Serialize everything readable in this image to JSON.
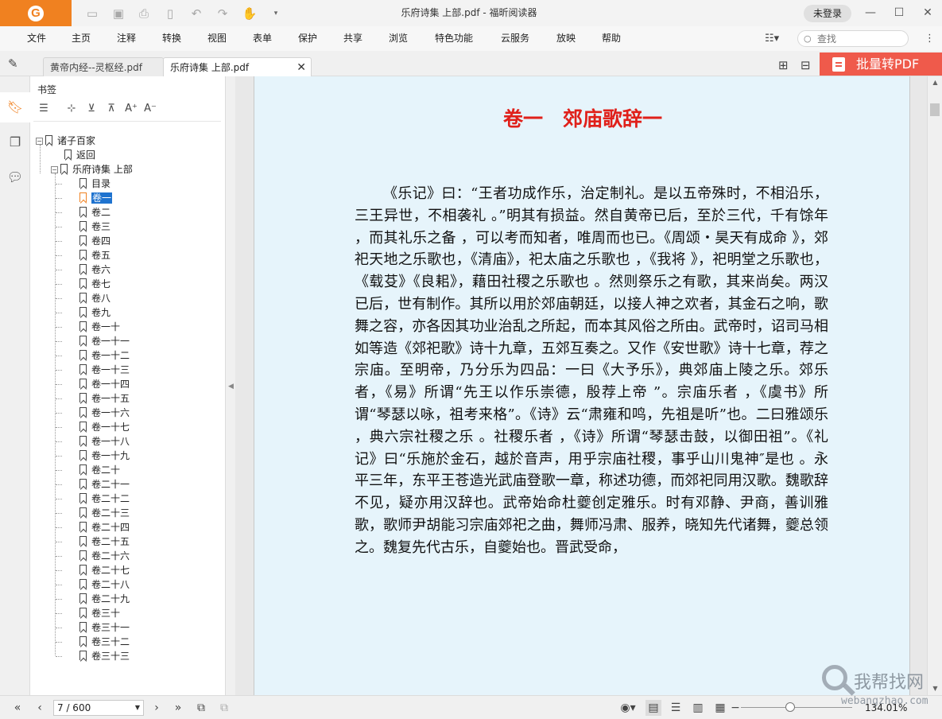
{
  "window": {
    "title": "乐府诗集  上部.pdf - 福昕阅读器",
    "login_label": "未登录"
  },
  "menu": {
    "items": [
      "文件",
      "主页",
      "注释",
      "转换",
      "视图",
      "表单",
      "保护",
      "共享",
      "浏览",
      "特色功能",
      "云服务",
      "放映",
      "帮助"
    ],
    "search_placeholder": "查找"
  },
  "tabs": [
    {
      "label": "黄帝内经--灵枢经.pdf",
      "active": false
    },
    {
      "label": "乐府诗集  上部.pdf",
      "active": true
    }
  ],
  "batch_convert_label": "批量转PDF",
  "bookmarks": {
    "panel_title": "书签",
    "root": "诸子百家",
    "back": "返回",
    "book": "乐府诗集  上部",
    "items": [
      "目录",
      "卷一",
      "卷二",
      "卷三",
      "卷四",
      "卷五",
      "卷六",
      "卷七",
      "卷八",
      "卷九",
      "卷一十",
      "卷一十一",
      "卷一十二",
      "卷一十三",
      "卷一十四",
      "卷一十五",
      "卷一十六",
      "卷一十七",
      "卷一十八",
      "卷一十九",
      "卷二十",
      "卷二十一",
      "卷二十二",
      "卷二十三",
      "卷二十四",
      "卷二十五",
      "卷二十六",
      "卷二十七",
      "卷二十八",
      "卷二十九",
      "卷三十",
      "卷三十一",
      "卷三十二",
      "卷三十三"
    ],
    "selected": "卷一"
  },
  "document": {
    "heading": "卷一　郊庙歌辞一",
    "body": "《乐记》曰：“王者功成作乐，治定制礼。是以五帝殊时，不相沿乐，三王异世，不相袭礼 。”明其有损益。然自黄帝已后，至於三代，千有馀年 ，而其礼乐之备 ，可以考而知者，唯周而也已。《周颂・昊天有成命 》，郊祀天地之乐歌也，《清庙》，祀太庙之乐歌也 ，《我将 》，祀明堂之乐歌也，《载芟》《良耜》，藉田社稷之乐歌也 。然则祭乐之有歌，其来尚矣。两汉已后，世有制作。其所以用於郊庙朝廷，以接人神之欢者，其金石之响，歌舞之容，亦各因其功业治乱之所起，而本其风俗之所由。武帝时，诏司马相如等造《郊祀歌》诗十九章，五郊互奏之。又作《安世歌》诗十七章，荐之宗庙。至明帝，乃分乐为四品：一曰《大予乐》，典郊庙上陵之乐。郊乐者，《易》所谓“先王以作乐崇德，殷荐上帝 ”。宗庙乐者 ，《虞书》所谓“琴瑟以咏，祖考来格”。《诗》云“肃雍和鸣，先祖是听”也。二曰雅颂乐 ，典六宗社稷之乐 。社稷乐者 ，《诗》所谓“琴瑟击鼓，以御田祖”。《礼记》曰“乐施於金石，越於音声，用乎宗庙社稷，事乎山川鬼神″是也 。永平三年，东平王苍造光武庙登歌一章，称述功德，而郊祀同用汉歌。魏歌辞不见，疑亦用汉辞也。武帝始命杜夔创定雅乐。时有邓静、尹商，善训雅歌，歌师尹胡能习宗庙郊祀之曲，舞师冯肃、服养，晓知先代诸舞，夔总领之。魏复先代古乐，自夔始也。晋武受命，"
  },
  "status": {
    "page_display": "7 / 600",
    "zoom": "134.01%"
  },
  "watermark": {
    "text": "我帮找网",
    "url": "webangzhao.com"
  }
}
